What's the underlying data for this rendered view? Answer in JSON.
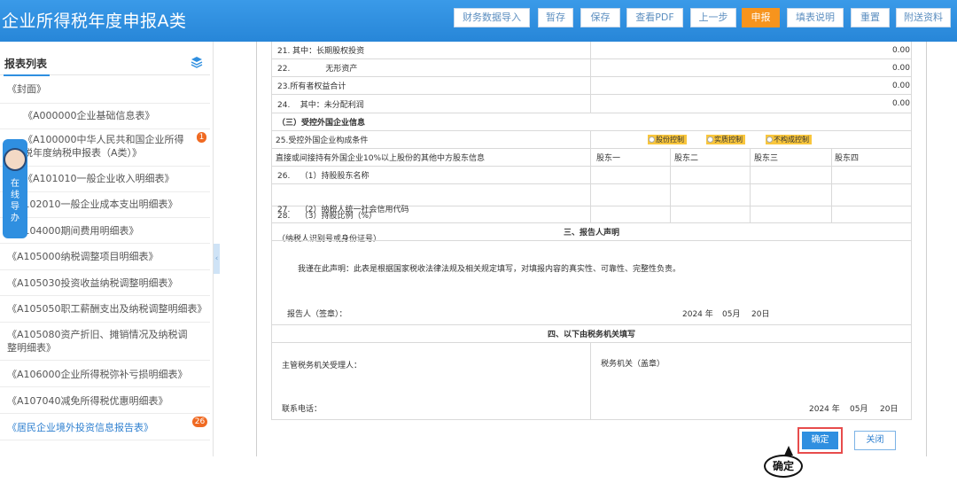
{
  "header": {
    "title": "企业所得税年度申报A类",
    "buttons": [
      "财务数据导入",
      "暂存",
      "保存",
      "查看PDF",
      "上一步",
      "申报",
      "填表说明",
      "重置",
      "附送资料"
    ]
  },
  "sidebar": {
    "title": "报表列表",
    "nav_widget": "在线导办",
    "items": [
      {
        "label": "《封面》"
      },
      {
        "label": "《A000000企业基础信息表》"
      },
      {
        "label": "《A100000中华人民共和国企业所得税年度纳税申报表（A类）》",
        "badge": "1"
      },
      {
        "label": "《A101010一般企业收入明细表》"
      },
      {
        "label": "《A102010一般企业成本支出明细表》"
      },
      {
        "label": "《A104000期间费用明细表》"
      },
      {
        "label": "《A105000纳税调整项目明细表》"
      },
      {
        "label": "《A105030投资收益纳税调整明细表》"
      },
      {
        "label": "《A105050职工薪酬支出及纳税调整明细表》"
      },
      {
        "label": "《A105080资产折旧、摊销情况及纳税调整明细表》"
      },
      {
        "label": "《A106000企业所得税弥补亏损明细表》"
      },
      {
        "label": "《A107040减免所得税优惠明细表》"
      },
      {
        "label": "《居民企业境外投资信息报告表》",
        "badge": "26"
      }
    ]
  },
  "form": {
    "rows": [
      {
        "label": "21.    其中：长期股权投资",
        "value": "0.00"
      },
      {
        "label": "22.              无形资产",
        "value": "0.00"
      },
      {
        "label": "23.所有者权益合计",
        "value": "0.00"
      },
      {
        "label": "24.    其中：未分配利润",
        "value": "0.00"
      }
    ],
    "section3": "（三）受控外国企业信息",
    "row25_label": "25.受控外国企业构成条件",
    "options": [
      "股份控制",
      "实质控制",
      "不构成控制"
    ],
    "shareholder_header": "直接或间接持有外国企业10%以上股份的其他中方股东信息",
    "shareholders": [
      "股东一",
      "股东二",
      "股东三",
      "股东四"
    ],
    "row26": "26.    （1）持股股东名称",
    "row27a": "27.    （2）纳税人统一社会信用代码",
    "row27b": "（纳税人识别号或身份证号）",
    "row28": "28.    （3）持股比例（%）",
    "declaration_title": "三、报告人声明",
    "declaration_text": "我谨在此声明：此表是根据国家税收法律法规及相关规定填写，对填报内容的真实性、可靠性、完整性负责。",
    "signer": "报告人（签章）：",
    "tax_title": "四、以下由税务机关填写",
    "receiver": "主管税务机关受理人：",
    "tax_office": "税务机关（盖章）",
    "phone": "联系电话：",
    "date_year": "2024 年",
    "date_month": "05月",
    "date_day": "20日"
  },
  "buttons": {
    "confirm": "确定",
    "close": "关闭"
  },
  "callout": "确定"
}
